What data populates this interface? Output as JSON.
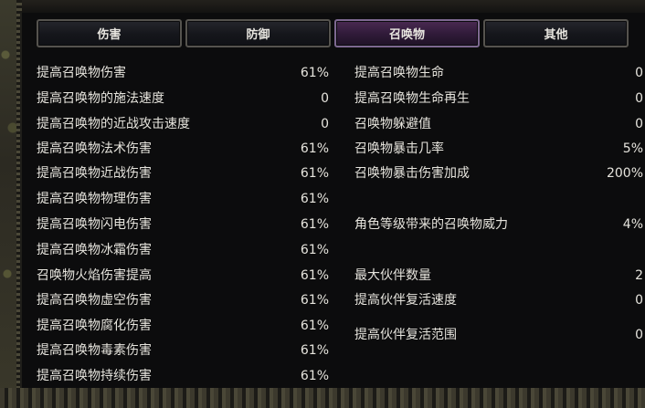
{
  "tabs": [
    {
      "label": "伤害",
      "active": false
    },
    {
      "label": "防御",
      "active": false
    },
    {
      "label": "召唤物",
      "active": true
    },
    {
      "label": "其他",
      "active": false
    }
  ],
  "left_stats": [
    {
      "label": "提高召唤物伤害",
      "value": "61%"
    },
    {
      "label": "提高召唤物的施法速度",
      "value": "0"
    },
    {
      "label": "提高召唤物的近战攻击速度",
      "value": "0"
    },
    {
      "label": "提高召唤物法术伤害",
      "value": "61%"
    },
    {
      "label": "提高召唤物近战伤害",
      "value": "61%"
    },
    {
      "label": "提高召唤物物理伤害",
      "value": "61%"
    },
    {
      "label": "提高召唤物闪电伤害",
      "value": "61%"
    },
    {
      "label": "提高召唤物冰霜伤害",
      "value": "61%"
    },
    {
      "label": "召唤物火焰伤害提高",
      "value": "61%"
    },
    {
      "label": "提高召唤物虚空伤害",
      "value": "61%"
    },
    {
      "label": "提高召唤物腐化伤害",
      "value": "61%"
    },
    {
      "label": "提高召唤物毒素伤害",
      "value": "61%"
    },
    {
      "label": "提高召唤物持续伤害",
      "value": "61%"
    }
  ],
  "right_stats": [
    {
      "label": "提高召唤物生命",
      "value": "0"
    },
    {
      "label": "提高召唤物生命再生",
      "value": "0"
    },
    {
      "label": "召唤物躲避值",
      "value": "0"
    },
    {
      "label": "召唤物暴击几率",
      "value": "5%"
    },
    {
      "label": "召唤物暴击伤害加成",
      "value": "200%"
    },
    {
      "label": "角色等级带来的召唤物威力",
      "value": "4%"
    },
    {
      "label": "最大伙伴数量",
      "value": "2"
    },
    {
      "label": "提高伙伴复活速度",
      "value": "0"
    },
    {
      "label": "提高伙伴复活范围",
      "value": "0"
    }
  ]
}
